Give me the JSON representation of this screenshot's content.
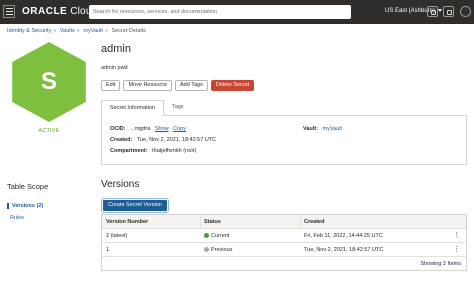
{
  "topbar": {
    "logo_brand": "ORACLE",
    "logo_product": "Cloud",
    "search_placeholder": "Search for resources, services, and documentation",
    "region": "US East (Ashburn)"
  },
  "breadcrumb": [
    "Identity & Security",
    "Vaults",
    "myVault",
    "Secret Details"
  ],
  "secret": {
    "icon_letter": "S",
    "status": "ACTIVE",
    "name": "admin",
    "description": "admin pwd"
  },
  "actions": [
    "Edit",
    "Move Resource",
    "Add Tags",
    "Delete Secret"
  ],
  "tabs": [
    "Secret Information",
    "Tags"
  ],
  "info": {
    "ocid_label": "OCID:",
    "ocid_value": "...mgdra",
    "show_link": "Show",
    "copy_link": "Copy",
    "created_label": "Created:",
    "created_value": "Tue, Nov 2, 2021, 18:42:57 UTC",
    "compartment_label": "Compartment:",
    "compartment_value": "thatjeffsmith (root)",
    "vault_label": "Vault:",
    "vault_value": "myVault"
  },
  "scope": {
    "title": "Table Scope",
    "items": [
      "Versions (2)",
      "Rules"
    ]
  },
  "versions": {
    "title": "Versions",
    "create_button": "Create Secret Version",
    "columns": [
      "Version Number",
      "Status",
      "Created"
    ],
    "rows": [
      {
        "number": "2 (latest)",
        "status": "Current",
        "created": "Fri, Feb 11, 2022, 14:44:25 UTC"
      },
      {
        "number": "1",
        "status": "Previous",
        "created": "Tue, Nov 2, 2021, 18:42:57 UTC"
      }
    ],
    "count_text": "Showing 2 Items",
    "status_colors": {
      "current": "#4a9a3a",
      "previous": "#a9a6a2"
    }
  },
  "colors": {
    "header_bg": "#312d2a",
    "hexagon": "#7fbf3f",
    "link": "#1e5c92",
    "danger": "#c74634",
    "active_status": "#66a12e"
  }
}
